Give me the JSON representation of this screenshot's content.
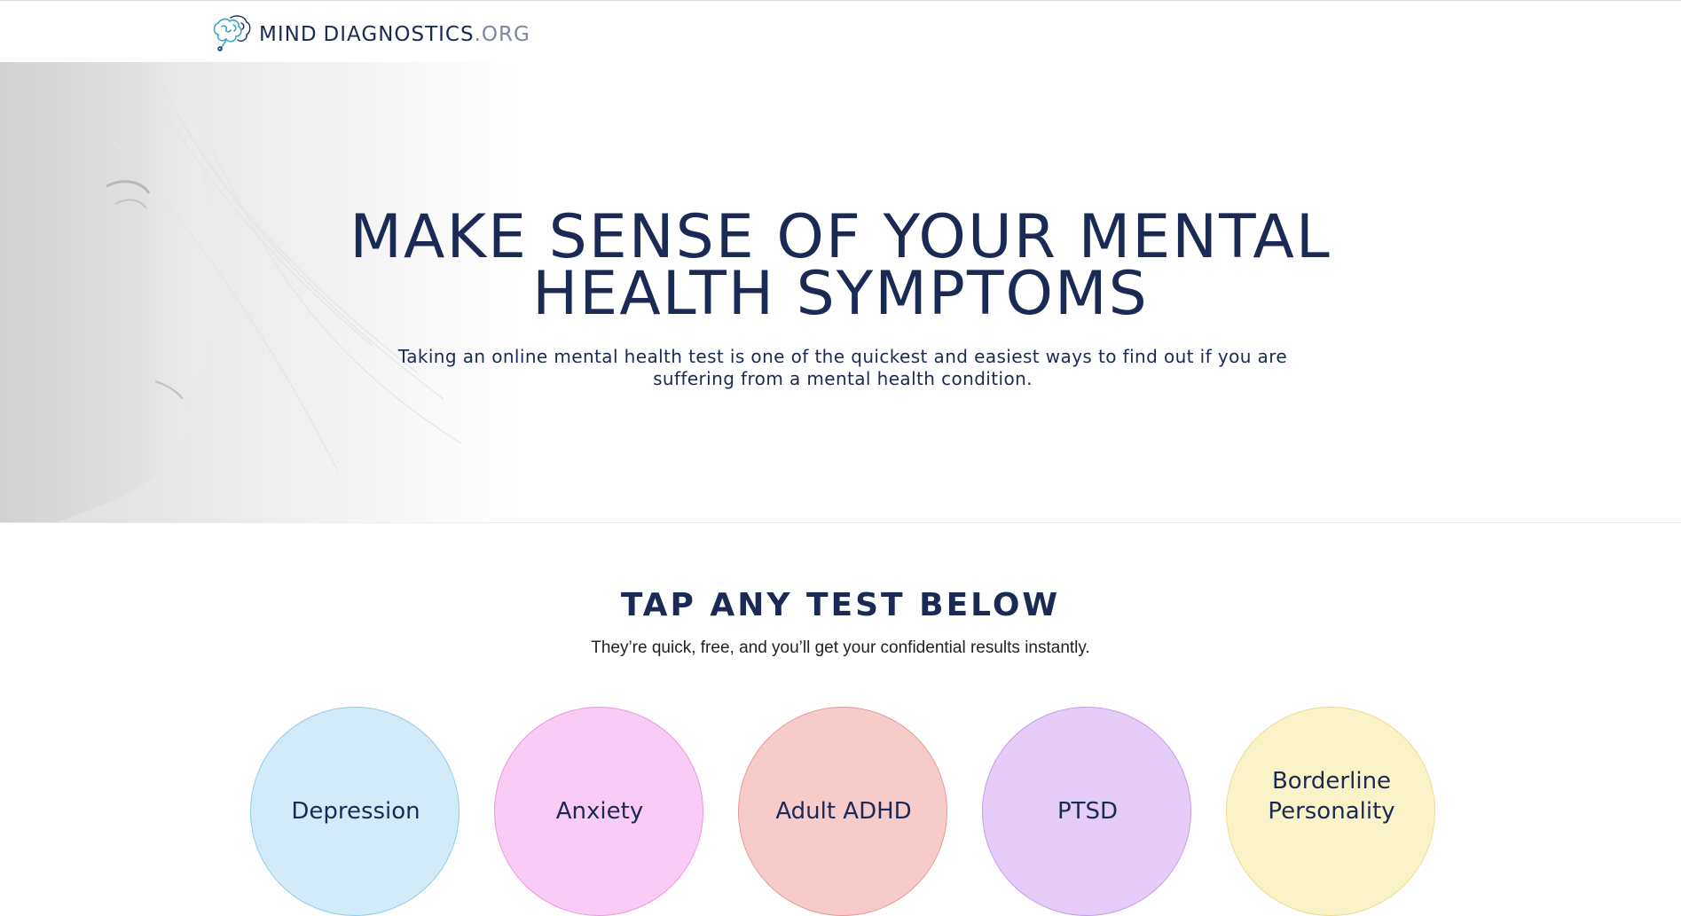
{
  "header": {
    "logo_icon": "brain-icon",
    "brand_part1": "MIND",
    "brand_part2": "DIAGNOSTICS",
    "brand_part3": ".ORG"
  },
  "hero": {
    "title_line1": "MAKE SENSE OF YOUR MENTAL",
    "title_line2": "HEALTH SYMPTOMS",
    "subtitle_line1": "Taking an online mental health test is one of the quickest and easiest ways to find out if you are",
    "subtitle_line2": "suffering from a mental health condition."
  },
  "tests_section": {
    "title": "TAP ANY TEST BELOW",
    "subtitle": "They’re quick, free, and you’ll get your confidential results instantly.",
    "tests": [
      {
        "line1": "Depression",
        "line2": "",
        "fill": "#d3ebf8",
        "border": "#8fcbe9"
      },
      {
        "line1": "Anxiety",
        "line2": "",
        "fill": "#f9cbf5",
        "border": "#e79ad9"
      },
      {
        "line1": "Adult ADHD",
        "line2": "",
        "fill": "#f8cbcb",
        "border": "#e39a9a"
      },
      {
        "line1": "PTSD",
        "line2": "",
        "fill": "#e6ccf8",
        "border": "#c49ce6"
      },
      {
        "line1": "Borderline",
        "line2": "Personality",
        "fill": "#faf3c8",
        "border": "#eddc8f"
      }
    ]
  },
  "colors": {
    "text_primary": "#1b2a55",
    "text_muted": "#7e8699"
  }
}
